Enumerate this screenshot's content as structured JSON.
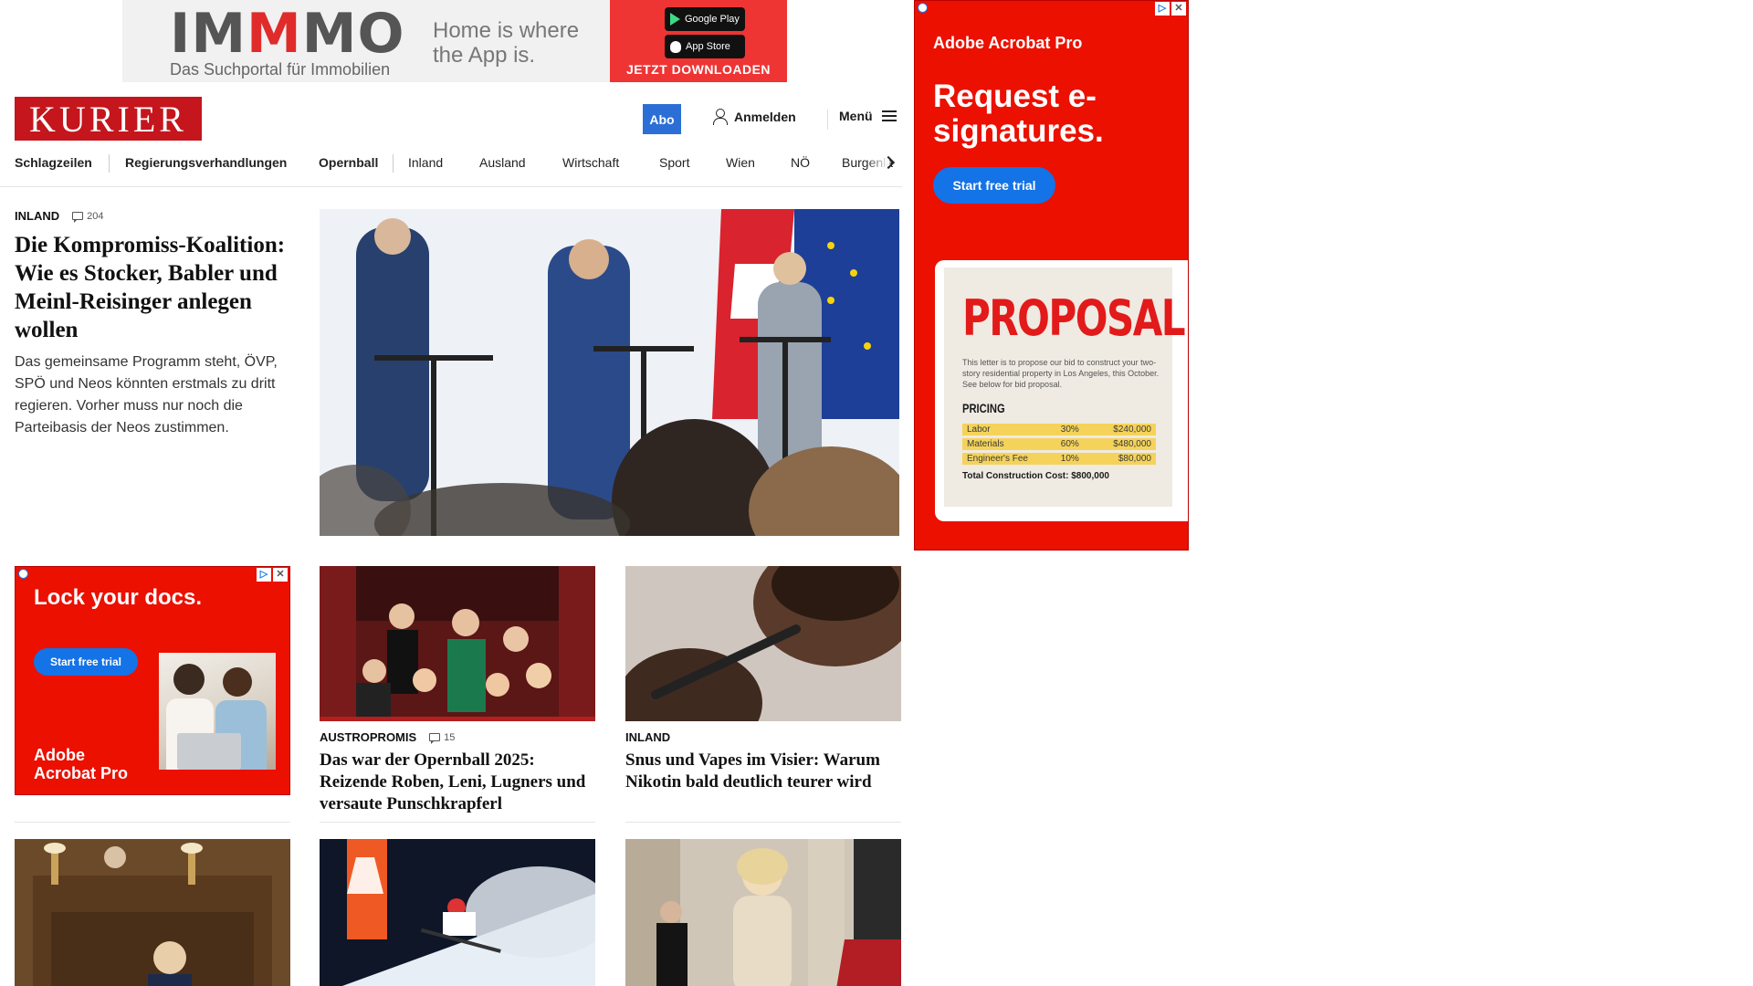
{
  "top_ad": {
    "brand": "IMMMO",
    "brand_sub": "Das Suchportal für Immobilien",
    "tagline": "Home is where the App is.",
    "google_play": "Google Play",
    "app_store": "App Store",
    "download_label": "JETZT DOWNLOADEN"
  },
  "header": {
    "logo": "KURIER",
    "abo_label": "Abo",
    "login_label": "Anmelden",
    "menu_label": "Menü"
  },
  "nav": {
    "items": [
      "Schlagzeilen",
      "Regierungsverhandlungen",
      "Opernball",
      "Inland",
      "Ausland",
      "Wirtschaft",
      "Sport",
      "Wien",
      "NÖ",
      "Burgenla"
    ]
  },
  "lead": {
    "kicker": "INLAND",
    "comments": "204",
    "title": "Die Kompromiss-Koalition: Wie es Stocker, Babler und Meinl-Reisinger anlegen wollen",
    "teaser": "Das gemeinsame Programm steht, ÖVP, SPÖ und Neos könnten erstmals zu dritt regieren. Vorher muss nur noch die Parteibasis der Neos zustimmen."
  },
  "cards": [
    {
      "kicker": "AUSTROPROMIS",
      "comments": "15",
      "title": "Das war der Opernball 2025: Reizende Roben, Leni, Lugners und versaute Punschkrapferl"
    },
    {
      "kicker": "INLAND",
      "comments": "",
      "title": "Snus und Vapes im Visier: Warum Nikotin bald deutlich teurer wird"
    }
  ],
  "side_ad": {
    "brand": "Adobe Acrobat Pro",
    "headline": "Request e-signatures.",
    "cta": "Start free trial",
    "doc_title": "PROPOSAL",
    "doc_letter": "This letter is to propose our bid to construct your two-story residential property in Los Angeles, this October. See below for bid proposal.",
    "pricing_label": "PRICING",
    "pricing_rows": [
      {
        "item": "Labor",
        "pct": "30%",
        "amount": "$240,000"
      },
      {
        "item": "Materials",
        "pct": "60%",
        "amount": "$480,000"
      },
      {
        "item": "Engineer's Fee",
        "pct": "10%",
        "amount": "$80,000"
      }
    ],
    "total": "Total Construction Cost: $800,000"
  },
  "mid_ad": {
    "headline": "Lock your docs.",
    "cta": "Start free trial",
    "brand_line1": "Adobe",
    "brand_line2": "Acrobat Pro"
  },
  "ad_badges": {
    "info": "▷",
    "close": "✕"
  },
  "colors": {
    "kurier_red": "#c4161c",
    "abo_blue": "#2b6fd6",
    "adobe_red": "#eb1000",
    "cta_blue": "#1473e6"
  }
}
